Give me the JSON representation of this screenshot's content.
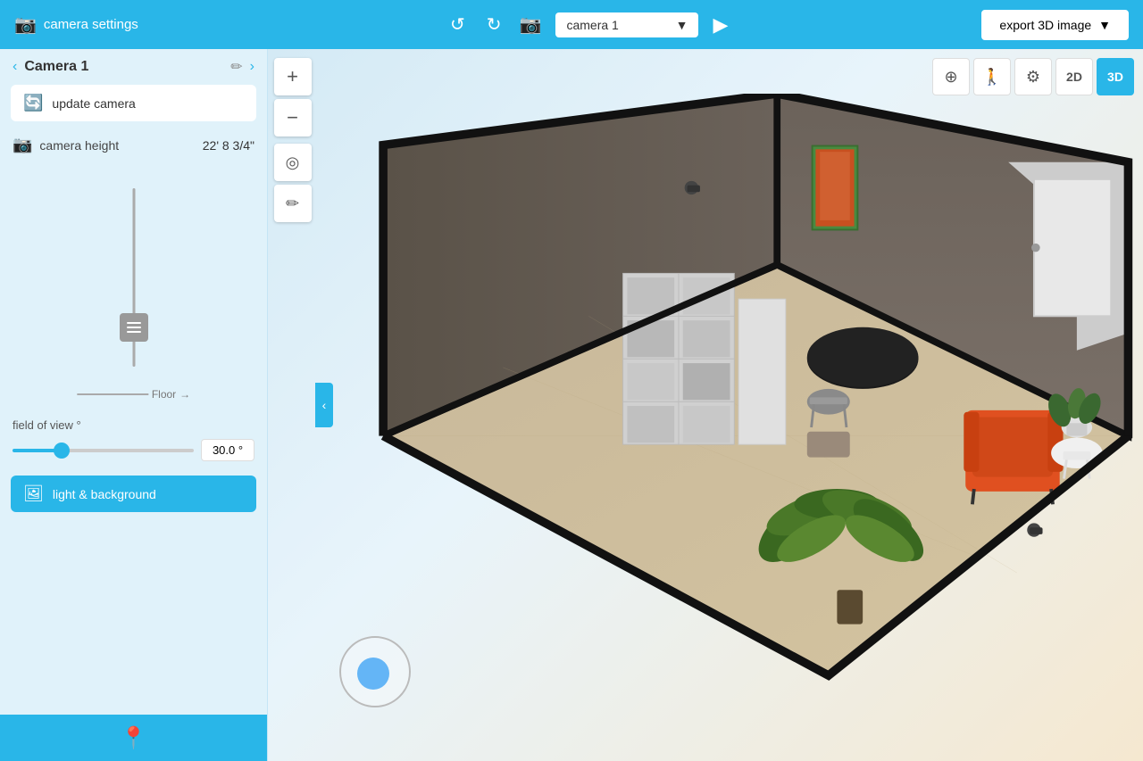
{
  "topbar": {
    "settings_label": "camera settings",
    "undo_label": "↺",
    "redo_label": "↻",
    "add_camera_icon": "📷",
    "camera_dropdown": {
      "value": "camera 1",
      "chevron": "▼"
    },
    "play_label": "▶",
    "export_label": "export 3D image",
    "export_chevron": "▼"
  },
  "left_panel": {
    "camera_nav": {
      "prev": "‹",
      "next": "›",
      "name": "Camera 1",
      "edit_icon": "✏"
    },
    "update_button": "update camera",
    "camera_height": {
      "label": "camera height",
      "value": "22' 8 3/4\""
    },
    "field_of_view": {
      "label": "field of view °",
      "value": "30.0 °",
      "slider_value": 30
    },
    "floor_label": "Floor",
    "light_bg_button": "light & background",
    "pin_icon": "📍"
  },
  "view_controls": {
    "orbit_icon": "⊕",
    "walk_icon": "🚶",
    "settings_icon": "⚙",
    "btn_2d": "2D",
    "btn_3d": "3D"
  },
  "zoom_toolbar": {
    "plus": "+",
    "minus": "−",
    "locate": "◎",
    "pen": "✏"
  }
}
